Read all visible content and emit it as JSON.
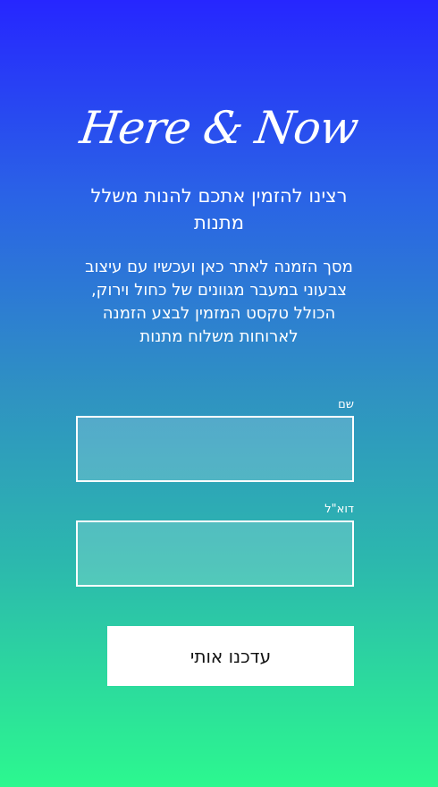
{
  "brand": {
    "logo_text": "Here & Now"
  },
  "intro": {
    "title": "רצינו להזמין אתכם להנות משלל מתנות",
    "description": "מסך הזמנה לאתר כאן ועכשיו עם עיצוב צבעוני במעבר מגוונים של כחול וירוק, הכולל טקסט המזמין לבצע הזמנה לארוחות משלוח מתנות"
  },
  "form": {
    "name_label": "שם",
    "name_value": "",
    "email_label": "דוא\"ל",
    "email_value": "",
    "submit_label": "עדכנו אותי"
  },
  "colors": {
    "gradient_top": "#2626ff",
    "gradient_bottom": "#2cf88f",
    "button_background": "#ffffff",
    "field_border": "#ffffff"
  }
}
